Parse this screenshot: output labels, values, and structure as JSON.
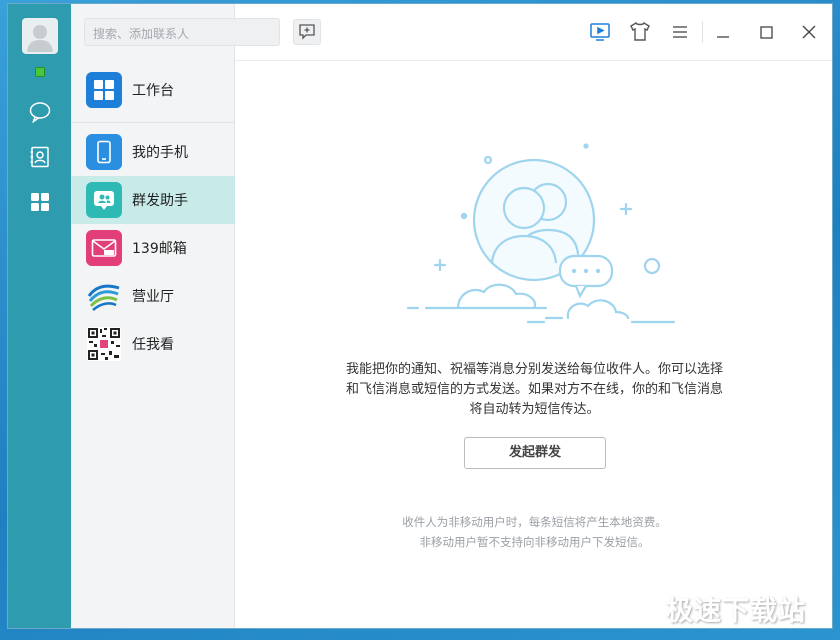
{
  "search": {
    "placeholder": "搜索、添加联系人"
  },
  "sidebar": {
    "items": [
      {
        "label": "工作台"
      },
      {
        "label": "我的手机"
      },
      {
        "label": "群发助手"
      },
      {
        "label": "139邮箱"
      },
      {
        "label": "营业厅"
      },
      {
        "label": "任我看"
      }
    ]
  },
  "main": {
    "description_lines": [
      "我能把你的通知、祝福等消息分别发送给每位收件人。你可以选择",
      "和飞信消息或短信的方式发送。如果对方不在线，你的和飞信消息",
      "将自动转为短信传达。"
    ],
    "start_button": "发起群发",
    "note_lines": [
      "收件人为非移动用户时，每条短信将产生本地资费。",
      "非移动用户暂不支持向非移动用户下发短信。"
    ]
  },
  "watermark": "极速下载站",
  "colors": {
    "rail": "#2e9bae",
    "active_item": "#c8ebe9",
    "accent_blue": "#1e7fd8",
    "status_online": "#46c83c"
  },
  "icons": {
    "rail": [
      "avatar",
      "chat-bubble-icon",
      "contacts-icon",
      "apps-grid-icon"
    ],
    "toolbar": [
      "screen-share-icon",
      "skin-tshirt-icon",
      "menu-icon",
      "minimize-icon",
      "maximize-icon",
      "close-icon"
    ]
  }
}
